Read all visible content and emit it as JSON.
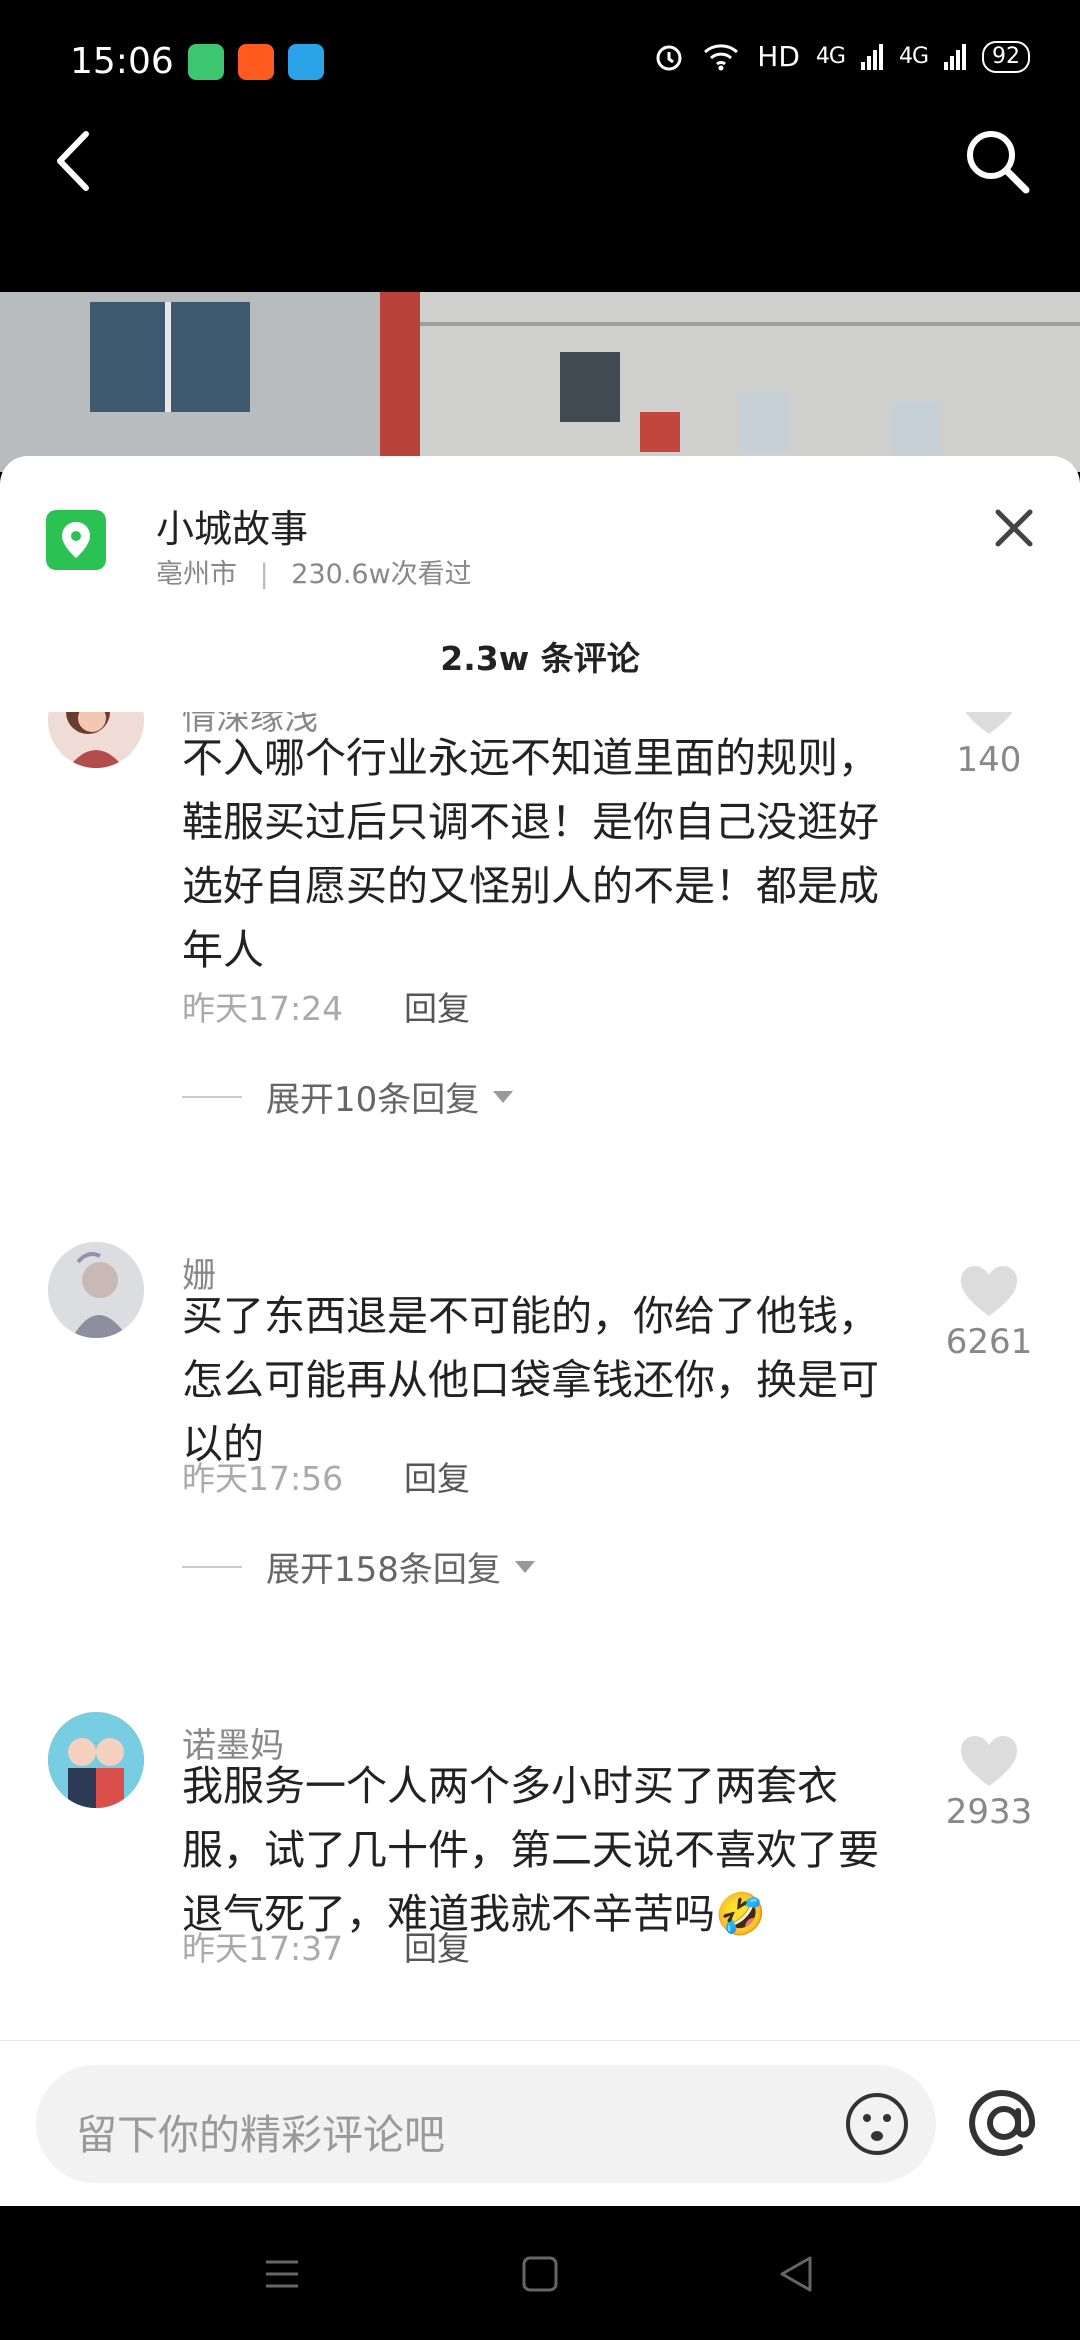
{
  "status_bar": {
    "time": "15:06",
    "network_label": "HD",
    "signal_1": "4G",
    "signal_2": "4G",
    "battery": "92"
  },
  "location": {
    "title": "小城故事",
    "city": "亳州市",
    "separator": "|",
    "views": "230.6w次看过"
  },
  "comment_header": "2.3w 条评论",
  "comments": [
    {
      "name": "情深缘浅",
      "text": "不入哪个行业永远不知道里面的规则，鞋服买过后只调不退！是你自己没逛好选好自愿买的又怪别人的不是！都是成年人",
      "time": "昨天17:24",
      "reply": "回复",
      "likes": "140",
      "expand": "展开10条回复"
    },
    {
      "name": "姗",
      "text": "买了东西退是不可能的，你给了他钱，怎么可能再从他口袋拿钱还你，换是可以的",
      "time": "昨天17:56",
      "reply": "回复",
      "likes": "6261",
      "expand": "展开158条回复"
    },
    {
      "name": "诺墨妈",
      "text": "我服务一个人两个多小时买了两套衣服，试了几十件，第二天说不喜欢了要退气死了，难道我就不辛苦吗🤣",
      "time": "昨天17:37",
      "reply": "回复",
      "likes": "2933"
    }
  ],
  "input": {
    "placeholder": "留下你的精彩评论吧"
  },
  "colors": {
    "accent_green": "#2bc253",
    "like_gray": "#dcdcdc"
  }
}
